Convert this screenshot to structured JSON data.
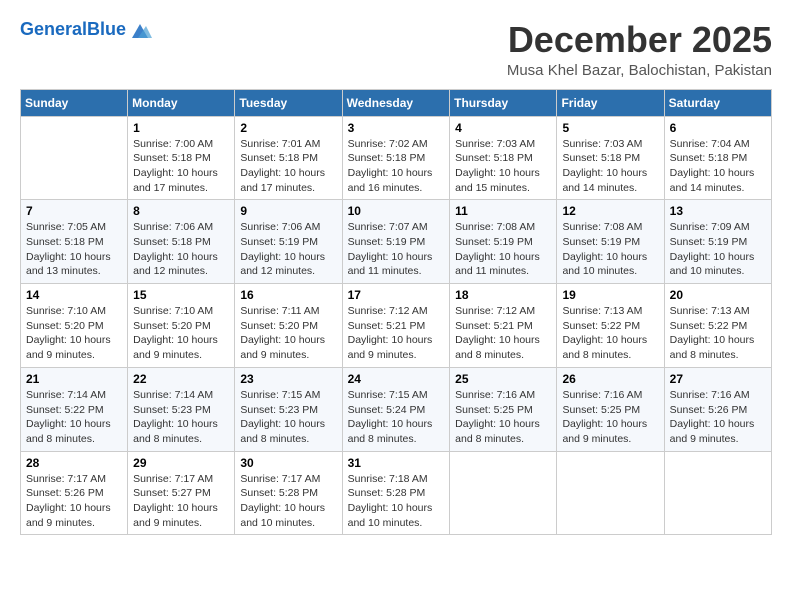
{
  "logo": {
    "text_general": "General",
    "text_blue": "Blue"
  },
  "header": {
    "month_title": "December 2025",
    "location": "Musa Khel Bazar, Balochistan, Pakistan"
  },
  "weekdays": [
    "Sunday",
    "Monday",
    "Tuesday",
    "Wednesday",
    "Thursday",
    "Friday",
    "Saturday"
  ],
  "weeks": [
    [
      {
        "day": "",
        "sunrise": "",
        "sunset": "",
        "daylight": ""
      },
      {
        "day": "1",
        "sunrise": "Sunrise: 7:00 AM",
        "sunset": "Sunset: 5:18 PM",
        "daylight": "Daylight: 10 hours and 17 minutes."
      },
      {
        "day": "2",
        "sunrise": "Sunrise: 7:01 AM",
        "sunset": "Sunset: 5:18 PM",
        "daylight": "Daylight: 10 hours and 17 minutes."
      },
      {
        "day": "3",
        "sunrise": "Sunrise: 7:02 AM",
        "sunset": "Sunset: 5:18 PM",
        "daylight": "Daylight: 10 hours and 16 minutes."
      },
      {
        "day": "4",
        "sunrise": "Sunrise: 7:03 AM",
        "sunset": "Sunset: 5:18 PM",
        "daylight": "Daylight: 10 hours and 15 minutes."
      },
      {
        "day": "5",
        "sunrise": "Sunrise: 7:03 AM",
        "sunset": "Sunset: 5:18 PM",
        "daylight": "Daylight: 10 hours and 14 minutes."
      },
      {
        "day": "6",
        "sunrise": "Sunrise: 7:04 AM",
        "sunset": "Sunset: 5:18 PM",
        "daylight": "Daylight: 10 hours and 14 minutes."
      }
    ],
    [
      {
        "day": "7",
        "sunrise": "Sunrise: 7:05 AM",
        "sunset": "Sunset: 5:18 PM",
        "daylight": "Daylight: 10 hours and 13 minutes."
      },
      {
        "day": "8",
        "sunrise": "Sunrise: 7:06 AM",
        "sunset": "Sunset: 5:18 PM",
        "daylight": "Daylight: 10 hours and 12 minutes."
      },
      {
        "day": "9",
        "sunrise": "Sunrise: 7:06 AM",
        "sunset": "Sunset: 5:19 PM",
        "daylight": "Daylight: 10 hours and 12 minutes."
      },
      {
        "day": "10",
        "sunrise": "Sunrise: 7:07 AM",
        "sunset": "Sunset: 5:19 PM",
        "daylight": "Daylight: 10 hours and 11 minutes."
      },
      {
        "day": "11",
        "sunrise": "Sunrise: 7:08 AM",
        "sunset": "Sunset: 5:19 PM",
        "daylight": "Daylight: 10 hours and 11 minutes."
      },
      {
        "day": "12",
        "sunrise": "Sunrise: 7:08 AM",
        "sunset": "Sunset: 5:19 PM",
        "daylight": "Daylight: 10 hours and 10 minutes."
      },
      {
        "day": "13",
        "sunrise": "Sunrise: 7:09 AM",
        "sunset": "Sunset: 5:19 PM",
        "daylight": "Daylight: 10 hours and 10 minutes."
      }
    ],
    [
      {
        "day": "14",
        "sunrise": "Sunrise: 7:10 AM",
        "sunset": "Sunset: 5:20 PM",
        "daylight": "Daylight: 10 hours and 9 minutes."
      },
      {
        "day": "15",
        "sunrise": "Sunrise: 7:10 AM",
        "sunset": "Sunset: 5:20 PM",
        "daylight": "Daylight: 10 hours and 9 minutes."
      },
      {
        "day": "16",
        "sunrise": "Sunrise: 7:11 AM",
        "sunset": "Sunset: 5:20 PM",
        "daylight": "Daylight: 10 hours and 9 minutes."
      },
      {
        "day": "17",
        "sunrise": "Sunrise: 7:12 AM",
        "sunset": "Sunset: 5:21 PM",
        "daylight": "Daylight: 10 hours and 9 minutes."
      },
      {
        "day": "18",
        "sunrise": "Sunrise: 7:12 AM",
        "sunset": "Sunset: 5:21 PM",
        "daylight": "Daylight: 10 hours and 8 minutes."
      },
      {
        "day": "19",
        "sunrise": "Sunrise: 7:13 AM",
        "sunset": "Sunset: 5:22 PM",
        "daylight": "Daylight: 10 hours and 8 minutes."
      },
      {
        "day": "20",
        "sunrise": "Sunrise: 7:13 AM",
        "sunset": "Sunset: 5:22 PM",
        "daylight": "Daylight: 10 hours and 8 minutes."
      }
    ],
    [
      {
        "day": "21",
        "sunrise": "Sunrise: 7:14 AM",
        "sunset": "Sunset: 5:22 PM",
        "daylight": "Daylight: 10 hours and 8 minutes."
      },
      {
        "day": "22",
        "sunrise": "Sunrise: 7:14 AM",
        "sunset": "Sunset: 5:23 PM",
        "daylight": "Daylight: 10 hours and 8 minutes."
      },
      {
        "day": "23",
        "sunrise": "Sunrise: 7:15 AM",
        "sunset": "Sunset: 5:23 PM",
        "daylight": "Daylight: 10 hours and 8 minutes."
      },
      {
        "day": "24",
        "sunrise": "Sunrise: 7:15 AM",
        "sunset": "Sunset: 5:24 PM",
        "daylight": "Daylight: 10 hours and 8 minutes."
      },
      {
        "day": "25",
        "sunrise": "Sunrise: 7:16 AM",
        "sunset": "Sunset: 5:25 PM",
        "daylight": "Daylight: 10 hours and 8 minutes."
      },
      {
        "day": "26",
        "sunrise": "Sunrise: 7:16 AM",
        "sunset": "Sunset: 5:25 PM",
        "daylight": "Daylight: 10 hours and 9 minutes."
      },
      {
        "day": "27",
        "sunrise": "Sunrise: 7:16 AM",
        "sunset": "Sunset: 5:26 PM",
        "daylight": "Daylight: 10 hours and 9 minutes."
      }
    ],
    [
      {
        "day": "28",
        "sunrise": "Sunrise: 7:17 AM",
        "sunset": "Sunset: 5:26 PM",
        "daylight": "Daylight: 10 hours and 9 minutes."
      },
      {
        "day": "29",
        "sunrise": "Sunrise: 7:17 AM",
        "sunset": "Sunset: 5:27 PM",
        "daylight": "Daylight: 10 hours and 9 minutes."
      },
      {
        "day": "30",
        "sunrise": "Sunrise: 7:17 AM",
        "sunset": "Sunset: 5:28 PM",
        "daylight": "Daylight: 10 hours and 10 minutes."
      },
      {
        "day": "31",
        "sunrise": "Sunrise: 7:18 AM",
        "sunset": "Sunset: 5:28 PM",
        "daylight": "Daylight: 10 hours and 10 minutes."
      },
      {
        "day": "",
        "sunrise": "",
        "sunset": "",
        "daylight": ""
      },
      {
        "day": "",
        "sunrise": "",
        "sunset": "",
        "daylight": ""
      },
      {
        "day": "",
        "sunrise": "",
        "sunset": "",
        "daylight": ""
      }
    ]
  ]
}
